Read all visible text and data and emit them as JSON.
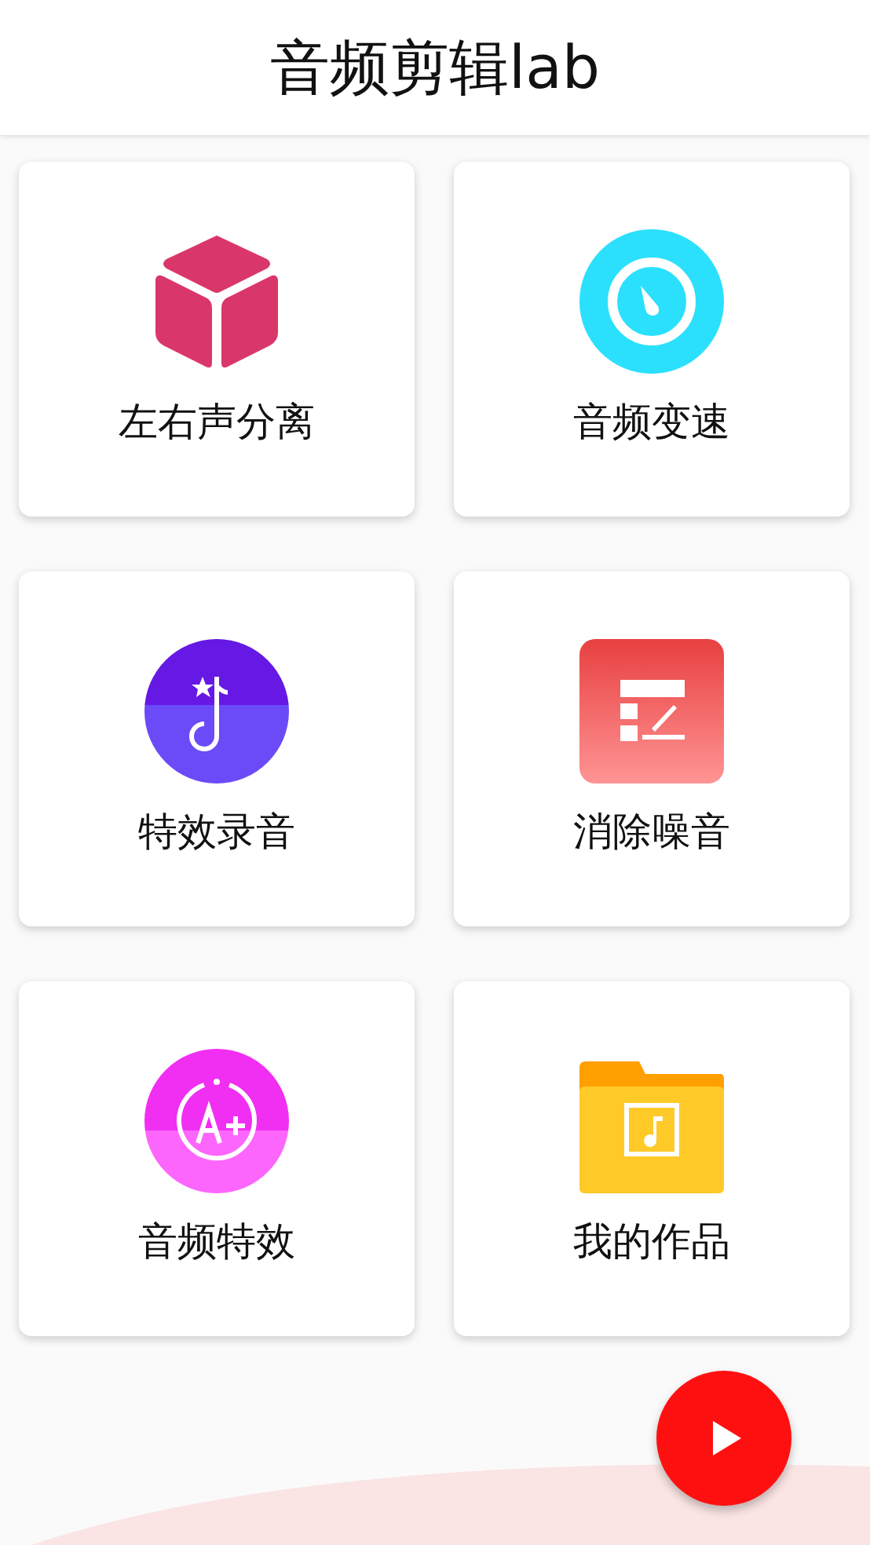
{
  "header": {
    "title": "音频剪辑lab"
  },
  "cards": [
    {
      "label": "左右声分离",
      "kind": "cube"
    },
    {
      "label": "音频变速",
      "kind": "gauge"
    },
    {
      "label": "特效录音",
      "kind": "note"
    },
    {
      "label": "消除噪音",
      "kind": "form"
    },
    {
      "label": "音频特效",
      "kind": "grade"
    },
    {
      "label": "我的作品",
      "kind": "folder"
    }
  ]
}
